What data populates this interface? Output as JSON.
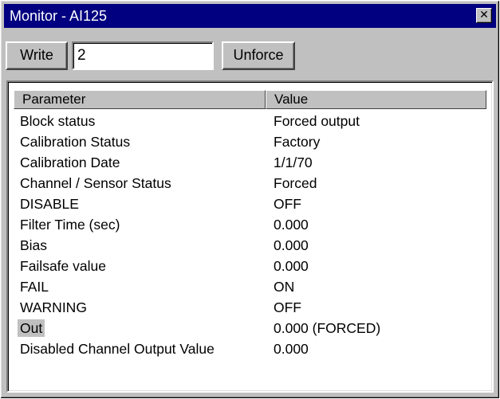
{
  "window": {
    "title": "Monitor - AI125",
    "close_glyph": "✕"
  },
  "toolbar": {
    "write_label": "Write",
    "write_value": "2",
    "unforce_label": "Unforce"
  },
  "table": {
    "columns": [
      "Parameter",
      "Value"
    ],
    "selected_row": "Out",
    "rows": [
      {
        "parameter": "Block status",
        "value": "Forced output"
      },
      {
        "parameter": "Calibration Status",
        "value": "Factory"
      },
      {
        "parameter": "Calibration Date",
        "value": "1/1/70"
      },
      {
        "parameter": "Channel / Sensor Status",
        "value": "Forced"
      },
      {
        "parameter": "DISABLE",
        "value": "OFF"
      },
      {
        "parameter": "Filter Time (sec)",
        "value": "0.000"
      },
      {
        "parameter": "Bias",
        "value": "0.000"
      },
      {
        "parameter": "Failsafe value",
        "value": "0.000"
      },
      {
        "parameter": "FAIL",
        "value": "ON"
      },
      {
        "parameter": "WARNING",
        "value": "OFF"
      },
      {
        "parameter": "Out",
        "value": "0.000 (FORCED)"
      },
      {
        "parameter": "Disabled Channel Output Value",
        "value": "0.000"
      }
    ]
  },
  "colors": {
    "title_bar": "#000080",
    "face": "#c0c0c0",
    "selection": "#c0c0c0"
  },
  "icons": {
    "close": "close-icon"
  }
}
